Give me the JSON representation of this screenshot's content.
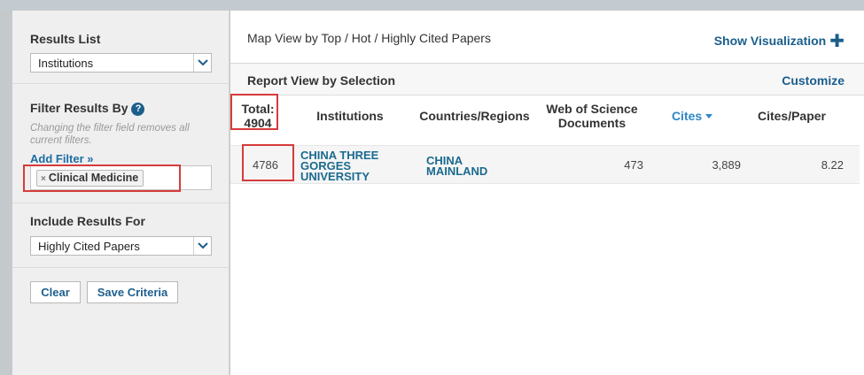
{
  "sidebar": {
    "results_list": {
      "label": "Results List",
      "selected": "Institutions"
    },
    "filter": {
      "label": "Filter Results By",
      "hint": "Changing the filter field removes all current filters.",
      "add_filter": "Add Filter »",
      "chips": [
        {
          "remove_glyph": "×",
          "label": "Clinical Medicine"
        }
      ]
    },
    "include": {
      "label": "Include Results For",
      "selected": "Highly Cited Papers"
    },
    "buttons": {
      "clear": "Clear",
      "save": "Save Criteria"
    }
  },
  "main": {
    "map_view": {
      "prefix": "Map View by ",
      "options": [
        "Top",
        "Hot",
        "Highly Cited Papers"
      ],
      "separator": " / "
    },
    "show_visualization": "Show Visualization",
    "report_title": "Report View by Selection",
    "customize": "Customize",
    "table": {
      "headers": {
        "total_label": "Total:",
        "total_value": "4904",
        "institutions": "Institutions",
        "countries": "Countries/Regions",
        "wos_line1": "Web of Science",
        "wos_line2": "Documents",
        "cites": "Cites",
        "cites_per_paper": "Cites/Paper"
      },
      "rows": [
        {
          "rank": "4786",
          "institution_lines": [
            "CHINA THREE",
            "GORGES",
            "UNIVERSITY"
          ],
          "country_lines": [
            "CHINA",
            "MAINLAND"
          ],
          "wos_documents": "473",
          "cites": "3,889",
          "cites_per_paper": "8.22"
        }
      ]
    }
  },
  "colors": {
    "link": "#1b5e8c",
    "highlight_box": "#d63b3b",
    "sort_link": "#2d87c6"
  }
}
